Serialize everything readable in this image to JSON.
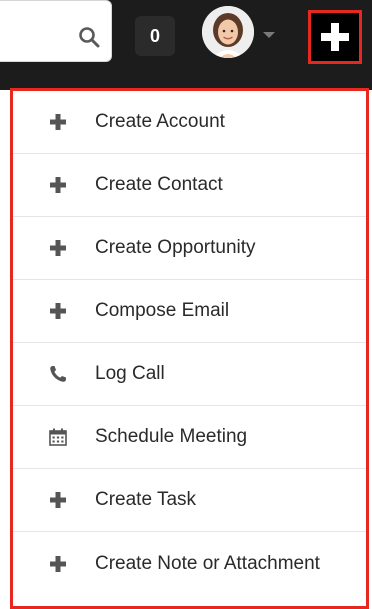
{
  "header": {
    "notification_count": "0",
    "icons": {
      "search": "search-icon",
      "avatar": "user-avatar",
      "avatar_caret": "caret-down-icon",
      "quick_create": "plus-icon"
    }
  },
  "colors": {
    "highlight": "#e8271e",
    "topbar": "#1c1c1c",
    "text": "#2a2a2a",
    "icon": "#555555"
  },
  "quick_create_menu": {
    "items": [
      {
        "label": "Create Account",
        "icon": "plus-icon"
      },
      {
        "label": "Create Contact",
        "icon": "plus-icon"
      },
      {
        "label": "Create Opportunity",
        "icon": "plus-icon"
      },
      {
        "label": "Compose Email",
        "icon": "plus-icon"
      },
      {
        "label": "Log Call",
        "icon": "phone-icon"
      },
      {
        "label": "Schedule Meeting",
        "icon": "calendar-icon"
      },
      {
        "label": "Create Task",
        "icon": "plus-icon"
      },
      {
        "label": "Create Note or Attachment",
        "icon": "plus-icon"
      }
    ]
  }
}
